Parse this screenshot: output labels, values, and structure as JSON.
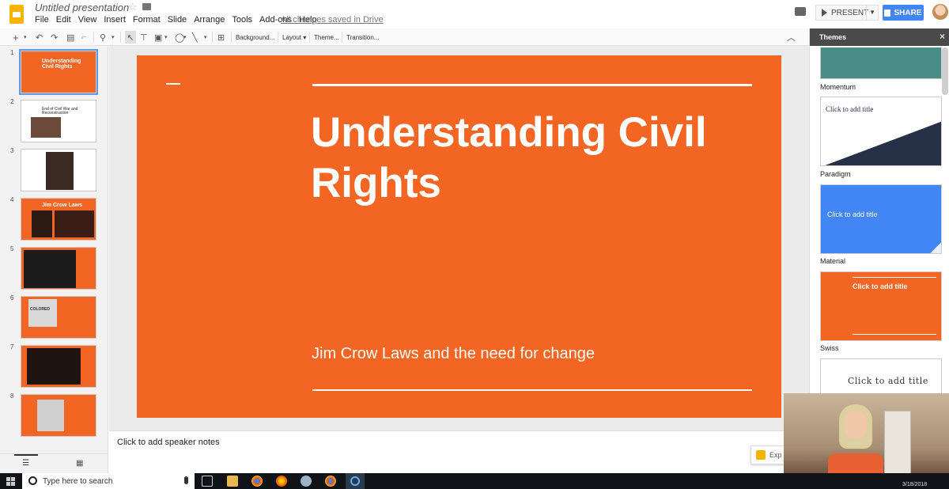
{
  "header": {
    "doc_title": "Untitled presentation",
    "menu": [
      "File",
      "Edit",
      "View",
      "Insert",
      "Format",
      "Slide",
      "Arrange",
      "Tools",
      "Add-ons",
      "Help"
    ],
    "save_status": "All changes saved in Drive",
    "present_label": "PRESENT",
    "share_label": "SHARE"
  },
  "toolbar": {
    "background_label": "Background...",
    "layout_label": "Layout",
    "theme_label": "Theme...",
    "transition_label": "Transition..."
  },
  "filmstrip": {
    "slides": [
      {
        "num": "1",
        "title": "Understanding Civil Rights"
      },
      {
        "num": "2",
        "title": "End of Civil War and Reconstruction"
      },
      {
        "num": "3"
      },
      {
        "num": "4",
        "title": "Jim Crow Laws"
      },
      {
        "num": "5"
      },
      {
        "num": "6",
        "sign_text": "COLORED"
      },
      {
        "num": "7"
      },
      {
        "num": "8"
      }
    ]
  },
  "slide": {
    "title": "Understanding Civil Rights",
    "subtitle": "Jim Crow Laws and the need for change"
  },
  "notes": {
    "placeholder": "Click to add speaker notes",
    "explore_label": "Exp"
  },
  "themes": {
    "header": "Themes",
    "items": [
      {
        "name": "Momentum",
        "title": "",
        "bg": "#4a8c86"
      },
      {
        "name": "Paradigm",
        "title": "Click to add title",
        "bg": "#ffffff"
      },
      {
        "name": "Material",
        "title": "Click to add title",
        "bg": "#4285f4"
      },
      {
        "name": "Swiss",
        "title": "Click to add title",
        "bg": "#f26522"
      },
      {
        "name": "",
        "title": "Click to add title",
        "bg": "#ffffff"
      }
    ]
  },
  "taskbar": {
    "search_placeholder": "Type here to search",
    "date": "3/18/2018"
  },
  "colors": {
    "slide_orange": "#f26522",
    "share_blue": "#4285f4",
    "selection_blue": "#5b9ce8"
  }
}
